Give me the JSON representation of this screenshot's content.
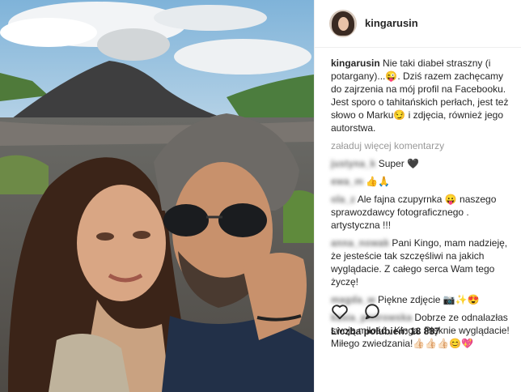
{
  "post": {
    "username": "kingarusin",
    "caption": {
      "username": "kingarusin",
      "text": "Nie taki diabeł straszny (i potargany)...😜. Dziś razem zachęcamy do zajrzenia na mój profil na Facebooku. Jest sporo o tahitańskich perłach, jest też słowo o Marku😏 i zdjęcia, również jego autorstwa."
    },
    "load_more": "załaduj więcej komentarzy",
    "comments": [
      {
        "user": "justyna_k",
        "text": "Super 🖤"
      },
      {
        "user": "ewa_m",
        "text": "👍🙏"
      },
      {
        "user": "ola_z",
        "text": "Ale fajna czupyrnka 😛 naszego sprawozdawcy fotograficznego . artystyczna !!!"
      },
      {
        "user": "anna_nowak",
        "text": "Pani Kingo, mam nadzieję, że jesteście tak szczęśliwi na jakich wyglądacie. Z całego serca Wam tego życzę!"
      },
      {
        "user": "magda_w",
        "text": "Piękne zdjęcie 📷✨😍"
      },
      {
        "user": "kasia_piotrowska",
        "text": "Dobrze ze odnalazłas swoją miłość , Kinga. Pięknie wyglądacie! Miłego zwiedzania!👍🏻👍🏻👍🏻😊💖"
      }
    ],
    "likes": "Liczba polubień: 18 887",
    "icons": {
      "like": "heart-icon",
      "comment": "comment-icon"
    }
  }
}
